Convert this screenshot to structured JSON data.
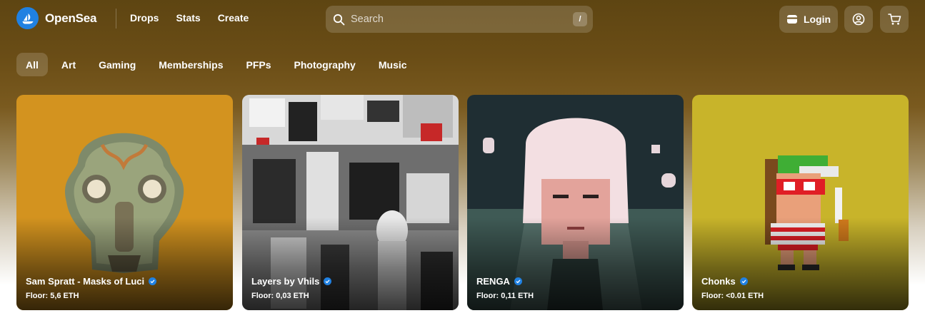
{
  "header": {
    "brand": "OpenSea",
    "nav": [
      {
        "label": "Drops"
      },
      {
        "label": "Stats"
      },
      {
        "label": "Create"
      }
    ],
    "search": {
      "placeholder": "Search",
      "shortcut": "/"
    },
    "login_label": "Login"
  },
  "categories": [
    {
      "label": "All",
      "active": true
    },
    {
      "label": "Art"
    },
    {
      "label": "Gaming"
    },
    {
      "label": "Memberships"
    },
    {
      "label": "PFPs"
    },
    {
      "label": "Photography"
    },
    {
      "label": "Music"
    }
  ],
  "collections": [
    {
      "name": "Sam Spratt - Masks of Luci",
      "floor": "Floor: 5,6 ETH",
      "verified": true
    },
    {
      "name": "Layers by Vhils",
      "floor": "Floor: 0,03 ETH",
      "verified": true
    },
    {
      "name": "RENGA",
      "floor": "Floor: 0,11 ETH",
      "verified": true
    },
    {
      "name": "Chonks",
      "floor": "Floor: <0.01 ETH",
      "verified": true
    }
  ],
  "colors": {
    "brand_blue": "#2081e2",
    "header_bg": "#5e4512"
  }
}
